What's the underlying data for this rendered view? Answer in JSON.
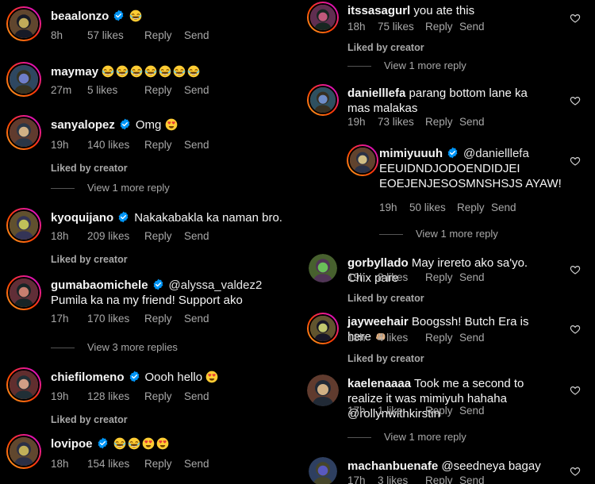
{
  "actions": {
    "reply": "Reply",
    "send": "Send"
  },
  "labels": {
    "liked_by_creator": "Liked by creator"
  },
  "left_comments": [
    {
      "username": "beaalonzo",
      "verified": true,
      "text": "",
      "mention": "",
      "emojis": [
        "laugh-emoji"
      ],
      "time": "8h",
      "likes": "57 likes",
      "liked_by_creator": false,
      "view_more": ""
    },
    {
      "username": "maymay",
      "verified": false,
      "text": "",
      "mention": "",
      "emojis": [
        "laugh-emoji",
        "laugh-emoji",
        "laugh-emoji",
        "laugh-emoji",
        "laugh-emoji",
        "laugh-emoji",
        "laugh-emoji"
      ],
      "time": "27m",
      "likes": "5 likes",
      "liked_by_creator": false,
      "view_more": ""
    },
    {
      "username": "sanyalopez",
      "verified": true,
      "text": "Omg",
      "mention": "",
      "emojis": [
        "heart-eyes-emoji"
      ],
      "time": "19h",
      "likes": "140 likes",
      "liked_by_creator": true,
      "view_more": "View 1 more reply"
    },
    {
      "username": "kyoquijano",
      "verified": true,
      "text": "Nakakabakla ka naman bro.",
      "mention": "",
      "emojis": [],
      "time": "18h",
      "likes": "209 likes",
      "liked_by_creator": true,
      "view_more": ""
    },
    {
      "username": "gumabaomichele",
      "verified": true,
      "mention": "@alyssa_valdez2",
      "text": "Pumila ka na my friend! Support ako",
      "emojis": [],
      "time": "17h",
      "likes": "170 likes",
      "liked_by_creator": false,
      "view_more": "View 3 more replies"
    },
    {
      "username": "chiefilomeno",
      "verified": true,
      "text": "Oooh hello",
      "mention": "",
      "emojis": [
        "heart-eyes-emoji"
      ],
      "time": "19h",
      "likes": "128 likes",
      "liked_by_creator": true,
      "view_more": ""
    },
    {
      "username": "lovipoe",
      "verified": true,
      "text": "",
      "mention": "",
      "emojis": [
        "laugh-emoji",
        "laugh-emoji",
        "heart-eyes-emoji",
        "heart-eyes-emoji"
      ],
      "time": "18h",
      "likes": "154 likes",
      "liked_by_creator": false,
      "view_more": ""
    }
  ],
  "right_comments": [
    {
      "username": "itssasagurl",
      "verified": false,
      "text": "you ate this",
      "mention": "",
      "emojis": [],
      "time": "18h",
      "likes": "75 likes",
      "liked_by_creator": true,
      "view_more": "View 1 more reply"
    },
    {
      "username": "danielllefa",
      "verified": false,
      "text": "parang bottom lane ka mas malakas",
      "mention": "",
      "emojis": [],
      "time": "19h",
      "likes": "73 likes",
      "liked_by_creator": false,
      "view_more": ""
    },
    {
      "username": "mimiyuuuh",
      "verified": true,
      "mention": "@danielllefa",
      "text": "EEUIDNDJODOENDIDJEI EOEJENJESOSMNSHSJS AYAW!",
      "emojis": [],
      "time": "19h",
      "likes": "50 likes",
      "liked_by_creator": false,
      "view_more": "View 1 more reply"
    },
    {
      "username": "gorbyllado",
      "verified": false,
      "text": "May irereto ako sa'yo. Chix pare",
      "mention": "",
      "emojis": [],
      "time": "19h",
      "likes": "8 likes",
      "liked_by_creator": true,
      "view_more": ""
    },
    {
      "username": "jayweehair",
      "verified": false,
      "text": "Boogssh! Butch Era is here",
      "mention": "",
      "emojis": [
        "fist-emoji"
      ],
      "time": "18h",
      "likes": "4 likes",
      "liked_by_creator": true,
      "view_more": ""
    },
    {
      "username": "kaelenaaaa",
      "verified": false,
      "text": "Took me a second to realize it was mimiyuh hahaha @rollynwithkirstin",
      "mention": "",
      "emojis": [],
      "time": "17h",
      "likes": "1 like",
      "liked_by_creator": false,
      "view_more": "View 1 more reply"
    },
    {
      "username": "machanbuenafe",
      "verified": false,
      "text": "@seedneya bagay",
      "mention": "",
      "emojis": [],
      "time": "17h",
      "likes": "3 likes",
      "liked_by_creator": false,
      "view_more": ""
    }
  ],
  "colors": {
    "background": "#000000",
    "text": "#f5f5f5",
    "muted": "#a8a8a8",
    "verified": "#0095f6",
    "ring_start": "#f9a825",
    "ring_mid": "#ff3d00",
    "ring_end": "#d500f9"
  }
}
